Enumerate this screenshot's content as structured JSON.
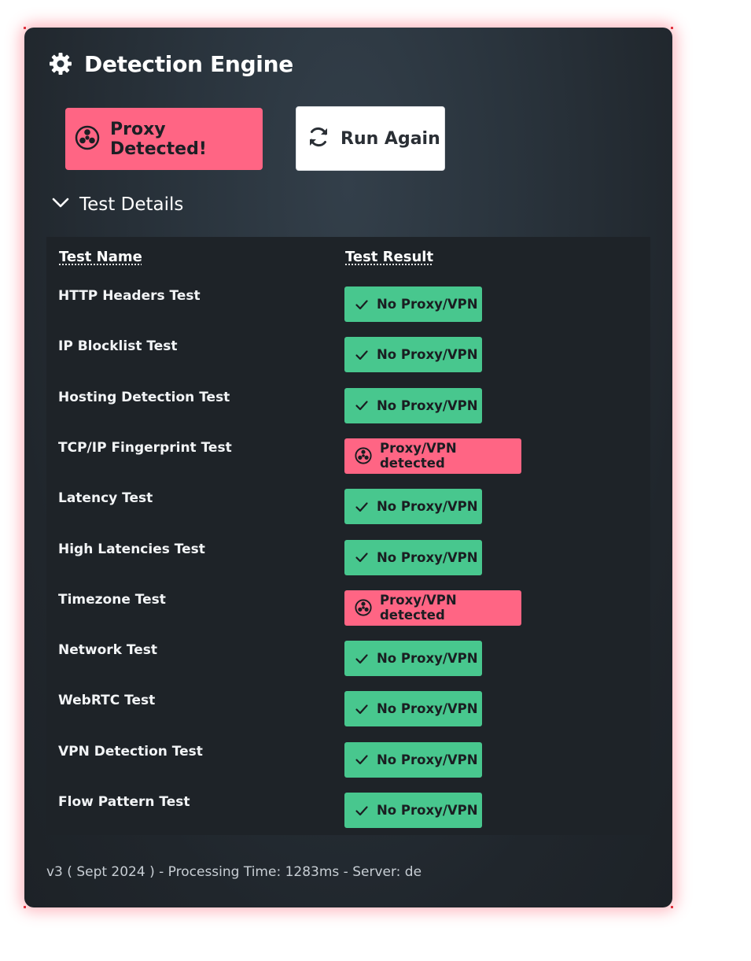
{
  "header": {
    "title": "Detection Engine",
    "icon": "gear-icon"
  },
  "status_button": {
    "label": "Proxy Detected!",
    "icon": "biohazard-icon",
    "color": "#ff6584"
  },
  "run_button": {
    "label": "Run Again",
    "icon": "refresh-icon"
  },
  "details": {
    "label": "Test Details",
    "expanded": true
  },
  "table": {
    "columns": [
      "Test Name",
      "Test Result"
    ],
    "rows": [
      {
        "name": "HTTP Headers Test",
        "result": "No Proxy/VPN",
        "status": "ok"
      },
      {
        "name": "IP Blocklist Test",
        "result": "No Proxy/VPN",
        "status": "ok"
      },
      {
        "name": "Hosting Detection Test",
        "result": "No Proxy/VPN",
        "status": "ok"
      },
      {
        "name": "TCP/IP Fingerprint Test",
        "result": "Proxy/VPN detected",
        "status": "detected"
      },
      {
        "name": "Latency Test",
        "result": "No Proxy/VPN",
        "status": "ok"
      },
      {
        "name": "High Latencies Test",
        "result": "No Proxy/VPN",
        "status": "ok"
      },
      {
        "name": "Timezone Test",
        "result": "Proxy/VPN detected",
        "status": "detected"
      },
      {
        "name": "Network Test",
        "result": "No Proxy/VPN",
        "status": "ok"
      },
      {
        "name": "WebRTC Test",
        "result": "No Proxy/VPN",
        "status": "ok"
      },
      {
        "name": "VPN Detection Test",
        "result": "No Proxy/VPN",
        "status": "ok"
      },
      {
        "name": "Flow Pattern Test",
        "result": "No Proxy/VPN",
        "status": "ok"
      }
    ]
  },
  "colors": {
    "ok": "#48c78e",
    "detected": "#ff6584"
  },
  "footer": {
    "text": "v3 ( Sept 2024 ) - Processing Time: 1283ms - Server: de"
  }
}
